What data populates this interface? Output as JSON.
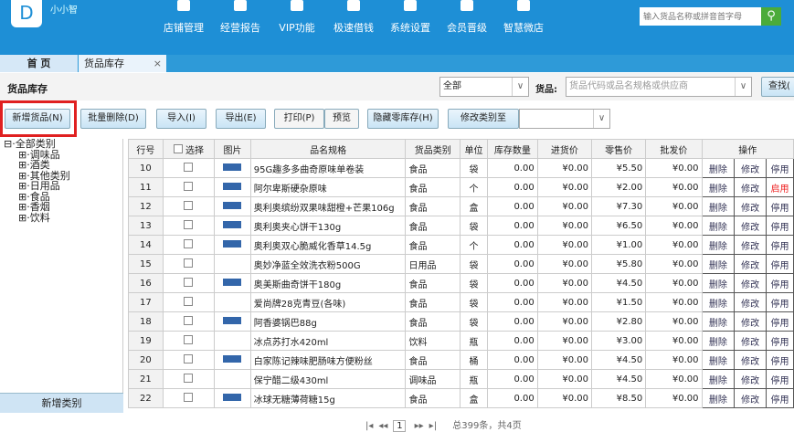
{
  "header": {
    "username": "小小智",
    "nav": [
      "店铺管理",
      "经营报告",
      "VIP功能",
      "极速借钱",
      "系统设置",
      "会员晋级",
      "智慧微店"
    ],
    "search_placeholder": "输入货品名称或拼音首字母"
  },
  "tabs": [
    {
      "label": "首 页"
    },
    {
      "label": "货品库存",
      "close": "×"
    }
  ],
  "page_title": "货品库存",
  "filter": {
    "category": "全部",
    "goods_label": "货品:",
    "goods_placeholder": "货品代码或品名规格或供应商",
    "search_btn": "查找("
  },
  "toolbar": {
    "add": "新增货品(N)",
    "batch_delete": "批量删除(D)",
    "import": "导入(I)",
    "export": "导出(E)",
    "print": "打印(P)",
    "preview": "预览",
    "hide_zero": "隐藏零库存(H)",
    "change_cat": "修改类别至",
    "change_cat_value": ""
  },
  "tree": {
    "root": "全部类别",
    "items": [
      "调味品",
      "酒类",
      "其他类别",
      "日用品",
      "食品",
      "香烟",
      "饮料"
    ],
    "add_button": "新增类别"
  },
  "table": {
    "headers": [
      "行号",
      "选择",
      "图片",
      "品名规格",
      "货品类别",
      "单位",
      "库存数量",
      "进货价",
      "零售价",
      "批发价",
      "操作"
    ],
    "rows": [
      [
        "10",
        "95G趣多多曲奇原味单卷装",
        "食品",
        "袋",
        "0.00",
        "¥0.00",
        "¥5.50",
        "¥0.00",
        "停用",
        true
      ],
      [
        "11",
        "阿尔卑斯硬杂原味",
        "食品",
        "个",
        "0.00",
        "¥0.00",
        "¥2.00",
        "¥0.00",
        "启用",
        true
      ],
      [
        "12",
        "奥利奥缤纷双果味甜橙+芒果106g",
        "食品",
        "盒",
        "0.00",
        "¥0.00",
        "¥7.30",
        "¥0.00",
        "停用",
        true
      ],
      [
        "13",
        "奥利奥夹心饼干130g",
        "食品",
        "袋",
        "0.00",
        "¥0.00",
        "¥6.50",
        "¥0.00",
        "停用",
        true
      ],
      [
        "14",
        "奥利奥双心脆威化香草14.5g",
        "食品",
        "个",
        "0.00",
        "¥0.00",
        "¥1.00",
        "¥0.00",
        "停用",
        true
      ],
      [
        "15",
        "奥妙净蓝全效洗衣粉500G",
        "日用品",
        "袋",
        "0.00",
        "¥0.00",
        "¥5.80",
        "¥0.00",
        "停用",
        false
      ],
      [
        "16",
        "奥美斯曲奇饼干180g",
        "食品",
        "袋",
        "0.00",
        "¥0.00",
        "¥4.50",
        "¥0.00",
        "停用",
        true
      ],
      [
        "17",
        "爱尚牌28克青豆(各味)",
        "食品",
        "袋",
        "0.00",
        "¥0.00",
        "¥1.50",
        "¥0.00",
        "停用",
        false
      ],
      [
        "18",
        "阿香婆锅巴88g",
        "食品",
        "袋",
        "0.00",
        "¥0.00",
        "¥2.80",
        "¥0.00",
        "停用",
        true
      ],
      [
        "19",
        "冰点苏打水420ml",
        "饮料",
        "瓶",
        "0.00",
        "¥0.00",
        "¥3.00",
        "¥0.00",
        "停用",
        false
      ],
      [
        "20",
        "白家陈记辣味肥肠味方便粉丝",
        "食品",
        "桶",
        "0.00",
        "¥0.00",
        "¥4.50",
        "¥0.00",
        "停用",
        true
      ],
      [
        "21",
        "保宁醋二级430ml",
        "调味品",
        "瓶",
        "0.00",
        "¥0.00",
        "¥4.50",
        "¥0.00",
        "停用",
        false
      ],
      [
        "22",
        "冰球无糖薄荷糖15g",
        "食品",
        "盒",
        "0.00",
        "¥0.00",
        "¥8.50",
        "¥0.00",
        "停用",
        true
      ]
    ],
    "delete": "删除",
    "edit": "修改"
  },
  "pager": {
    "page": "1",
    "summary": "总399条，共4页"
  },
  "colors": {
    "header": "#1e8fd6",
    "highlight": "#e02020",
    "enable": "#e22222"
  }
}
